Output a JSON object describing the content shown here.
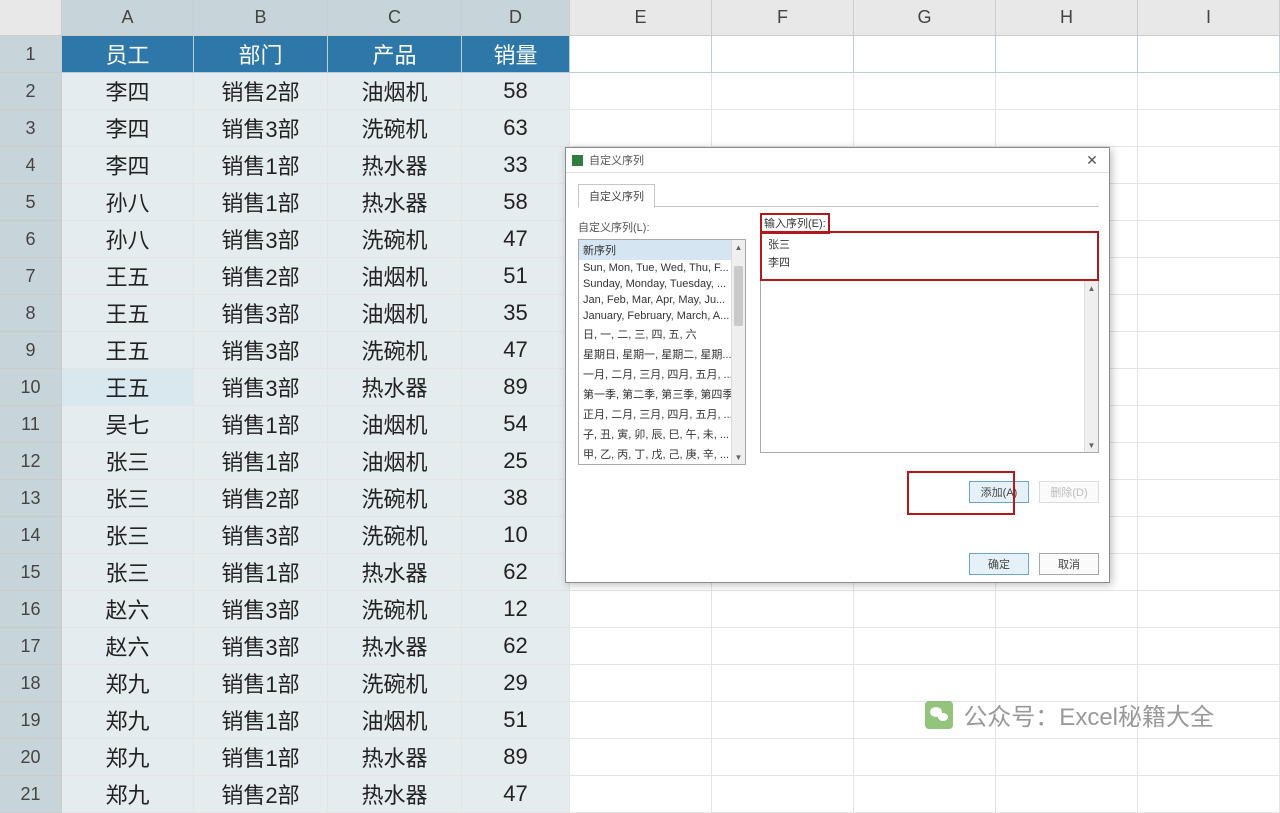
{
  "columns": [
    "A",
    "B",
    "C",
    "D",
    "E",
    "F",
    "G",
    "H",
    "I"
  ],
  "selected_cols": [
    "A",
    "B",
    "C",
    "D"
  ],
  "headers": {
    "A": "员工",
    "B": "部门",
    "C": "产品",
    "D": "销量"
  },
  "rows": [
    {
      "n": 1,
      "a": "员工",
      "b": "部门",
      "c": "产品",
      "d": "销量",
      "header": true
    },
    {
      "n": 2,
      "a": "李四",
      "b": "销售2部",
      "c": "油烟机",
      "d": "58"
    },
    {
      "n": 3,
      "a": "李四",
      "b": "销售3部",
      "c": "洗碗机",
      "d": "63"
    },
    {
      "n": 4,
      "a": "李四",
      "b": "销售1部",
      "c": "热水器",
      "d": "33"
    },
    {
      "n": 5,
      "a": "孙八",
      "b": "销售1部",
      "c": "热水器",
      "d": "58"
    },
    {
      "n": 6,
      "a": "孙八",
      "b": "销售3部",
      "c": "洗碗机",
      "d": "47"
    },
    {
      "n": 7,
      "a": "王五",
      "b": "销售2部",
      "c": "油烟机",
      "d": "51"
    },
    {
      "n": 8,
      "a": "王五",
      "b": "销售3部",
      "c": "油烟机",
      "d": "35"
    },
    {
      "n": 9,
      "a": "王五",
      "b": "销售3部",
      "c": "洗碗机",
      "d": "47"
    },
    {
      "n": 10,
      "a": "王五",
      "b": "销售3部",
      "c": "热水器",
      "d": "89",
      "active": true
    },
    {
      "n": 11,
      "a": "吴七",
      "b": "销售1部",
      "c": "油烟机",
      "d": "54"
    },
    {
      "n": 12,
      "a": "张三",
      "b": "销售1部",
      "c": "油烟机",
      "d": "25"
    },
    {
      "n": 13,
      "a": "张三",
      "b": "销售2部",
      "c": "洗碗机",
      "d": "38"
    },
    {
      "n": 14,
      "a": "张三",
      "b": "销售3部",
      "c": "洗碗机",
      "d": "10"
    },
    {
      "n": 15,
      "a": "张三",
      "b": "销售1部",
      "c": "热水器",
      "d": "62"
    },
    {
      "n": 16,
      "a": "赵六",
      "b": "销售3部",
      "c": "洗碗机",
      "d": "12"
    },
    {
      "n": 17,
      "a": "赵六",
      "b": "销售3部",
      "c": "热水器",
      "d": "62"
    },
    {
      "n": 18,
      "a": "郑九",
      "b": "销售1部",
      "c": "洗碗机",
      "d": "29"
    },
    {
      "n": 19,
      "a": "郑九",
      "b": "销售1部",
      "c": "油烟机",
      "d": "51"
    },
    {
      "n": 20,
      "a": "郑九",
      "b": "销售1部",
      "c": "热水器",
      "d": "89"
    },
    {
      "n": 21,
      "a": "郑九",
      "b": "销售2部",
      "c": "热水器",
      "d": "47"
    }
  ],
  "dialog": {
    "title": "自定义序列",
    "tab": "自定义序列",
    "list_label": "自定义序列(L):",
    "entry_label": "输入序列(E):",
    "list_items": [
      "新序列",
      "Sun, Mon, Tue, Wed, Thu, F...",
      "Sunday, Monday, Tuesday, ...",
      "Jan, Feb, Mar, Apr, May, Ju...",
      "January, February, March, A...",
      "日, 一, 二, 三, 四, 五, 六",
      "星期日, 星期一, 星期二, 星期...",
      "一月, 二月, 三月, 四月, 五月, ...",
      "第一季, 第二季, 第三季, 第四季",
      "正月, 二月, 三月, 四月, 五月, ...",
      "子, 丑, 寅, 卯, 辰, 巳, 午, 未, ...",
      "甲, 乙, 丙, 丁, 戊, 己, 庚, 辛, ..."
    ],
    "entry_lines": [
      "张三",
      "李四"
    ],
    "btn_add": "添加(A)",
    "btn_delete": "删除(D)",
    "btn_ok": "确定",
    "btn_cancel": "取消"
  },
  "watermark": "公众号：Excel秘籍大全"
}
